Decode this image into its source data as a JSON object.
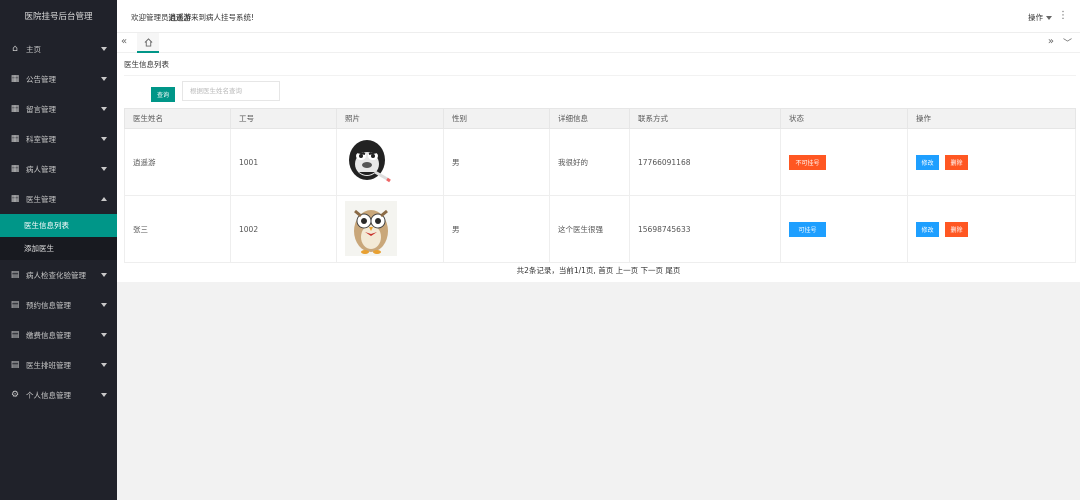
{
  "sidebar": {
    "logo": "医院挂号后台管理",
    "items": [
      {
        "label": "主页",
        "icon": "home-icon"
      },
      {
        "label": "公告管理",
        "icon": "grid-icon"
      },
      {
        "label": "留言管理",
        "icon": "grid-icon"
      },
      {
        "label": "科室管理",
        "icon": "grid-icon"
      },
      {
        "label": "病人管理",
        "icon": "grid-icon"
      },
      {
        "label": "医生管理",
        "icon": "grid-icon",
        "expanded": true,
        "children": [
          {
            "label": "医生信息列表",
            "active": true
          },
          {
            "label": "添加医生"
          }
        ]
      },
      {
        "label": "病人检查化验管理",
        "icon": "calendar-icon"
      },
      {
        "label": "预约信息管理",
        "icon": "calendar-icon"
      },
      {
        "label": "缴费信息管理",
        "icon": "calendar-icon"
      },
      {
        "label": "医生排班管理",
        "icon": "calendar-icon"
      },
      {
        "label": "个人信息管理",
        "icon": "gear-icon"
      }
    ]
  },
  "header": {
    "welcome_prefix": "欢迎管理员",
    "welcome_user": "逍遥游",
    "welcome_suffix": "来到病人挂号系统!",
    "op_label": "操作",
    "more_label": "⋮"
  },
  "tabs": {
    "prev": "«",
    "next": "»",
    "down": "﹀"
  },
  "main": {
    "page_title": "医生信息列表",
    "search_button": "查询",
    "search_placeholder": "根据医生姓名查询",
    "columns": [
      "医生姓名",
      "工号",
      "照片",
      "性别",
      "详细信息",
      "联系方式",
      "状态",
      "操作"
    ],
    "rows": [
      {
        "name": "逍遥游",
        "no": "1001",
        "photo": "gorilla-avatar",
        "sex": "男",
        "intro": "我很好的",
        "phone": "17766091168",
        "status": "不可挂号",
        "status_color": "#ff5722",
        "edit": "修改",
        "delete": "删除"
      },
      {
        "name": "张三",
        "no": "1002",
        "photo": "owl-avatar",
        "sex": "男",
        "intro": "这个医生很强",
        "phone": "15698745633",
        "status": "可挂号",
        "status_color": "#1e9fff",
        "edit": "修改",
        "delete": "删除"
      }
    ],
    "pager": {
      "summary": "共2条记录，当前1/1页,",
      "first": "首页",
      "prev": "上一页",
      "next": "下一页",
      "last": "尾页"
    }
  },
  "colors": {
    "sidebar_bg": "#20222a",
    "accent": "#009688",
    "danger": "#ff5722",
    "info": "#1e9fff"
  }
}
